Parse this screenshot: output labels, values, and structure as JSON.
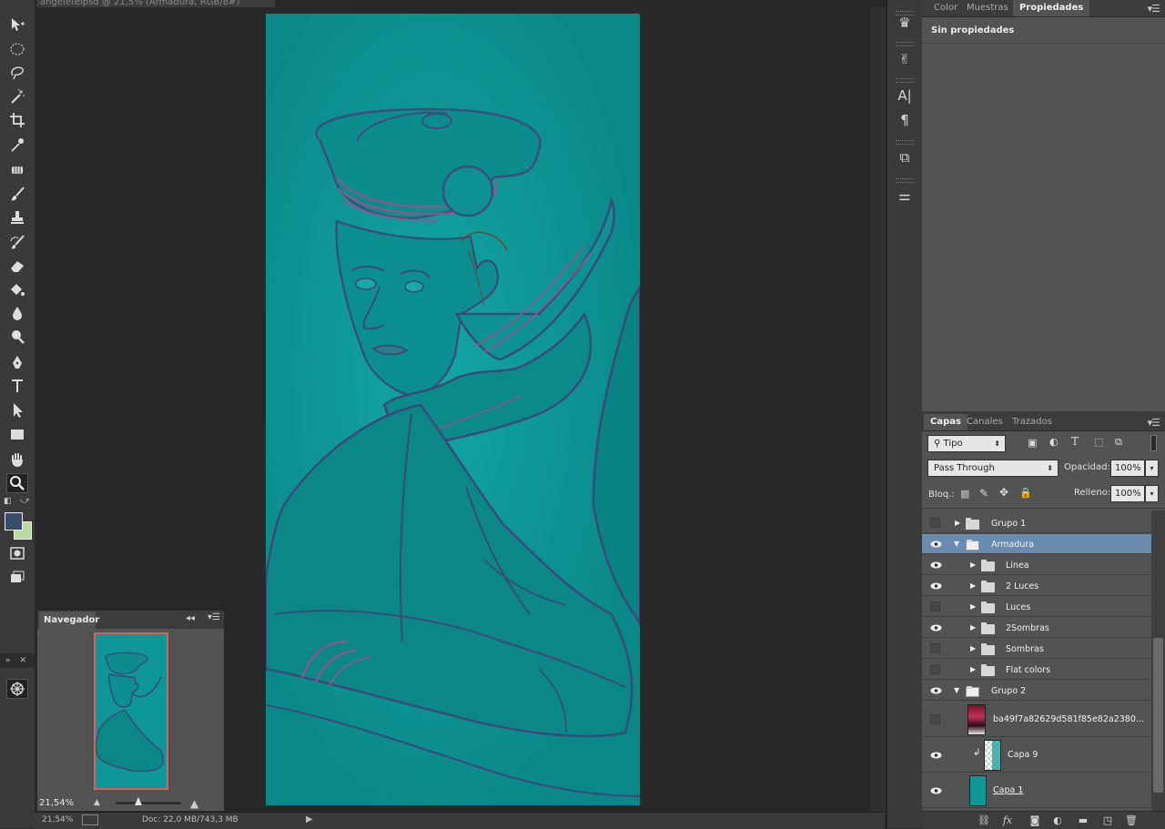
{
  "document": {
    "tab_title": "angeleteipsd @ 21,5% (Armadura, RGB/8#)"
  },
  "toolbar": {
    "tools": [
      "move-icon",
      "elliptical-marquee-icon",
      "lasso-icon",
      "magic-wand-icon",
      "crop-icon",
      "eyedropper-icon",
      "healing-brush-icon",
      "brush-icon",
      "clone-stamp-icon",
      "history-brush-icon",
      "eraser-icon",
      "paint-bucket-icon",
      "blur-icon",
      "dodge-icon",
      "pen-icon",
      "type-icon",
      "path-selection-icon",
      "rectangle-icon",
      "hand-icon",
      "zoom-icon"
    ],
    "foreground_color": "#3b4b6a",
    "background_color": "#b8dca0"
  },
  "navigator": {
    "tab": "Navegador",
    "zoom": "21,54%"
  },
  "status": {
    "zoom": "21,54%",
    "doc": "Doc: 22,0 MB/743,3 MB"
  },
  "properties_panel": {
    "tabs": [
      "Color",
      "Muestras",
      "Propiedades"
    ],
    "active_tab": "Propiedades",
    "body_title": "Sin propiedades"
  },
  "layers_panel": {
    "tabs": [
      "Capas",
      "Canales",
      "Trazados"
    ],
    "active_tab": "Capas",
    "filter_label": "Tipo",
    "blend_mode": "Pass Through",
    "opacity_label": "Opacidad:",
    "opacity_value": "100%",
    "lock_label": "Bloq.:",
    "fill_label": "Relleno:",
    "fill_value": "100%",
    "layers": [
      {
        "name": "Grupo 1",
        "visible": false,
        "type": "group",
        "expanded": false,
        "indent": 0
      },
      {
        "name": "Armadura",
        "visible": true,
        "type": "group",
        "expanded": true,
        "indent": 0,
        "selected": true
      },
      {
        "name": "Linea",
        "visible": true,
        "type": "group",
        "expanded": false,
        "indent": 1
      },
      {
        "name": "2 Luces",
        "visible": true,
        "type": "group",
        "expanded": false,
        "indent": 1
      },
      {
        "name": "Luces",
        "visible": false,
        "type": "group",
        "expanded": false,
        "indent": 1
      },
      {
        "name": "2Sombras",
        "visible": true,
        "type": "group",
        "expanded": false,
        "indent": 1
      },
      {
        "name": "Sombras",
        "visible": false,
        "type": "group",
        "expanded": false,
        "indent": 1
      },
      {
        "name": "Flat colors",
        "visible": false,
        "type": "group",
        "expanded": false,
        "indent": 1
      },
      {
        "name": "Grupo 2",
        "visible": true,
        "type": "group",
        "expanded": true,
        "indent": 0
      },
      {
        "name": "ba49f7a82629d581f85e82a2380...",
        "visible": false,
        "type": "image",
        "indent": 1
      },
      {
        "name": "Capa 9",
        "visible": true,
        "type": "clipped",
        "indent": 1
      },
      {
        "name": "Capa 1",
        "visible": true,
        "type": "fill",
        "indent": 0
      }
    ]
  }
}
